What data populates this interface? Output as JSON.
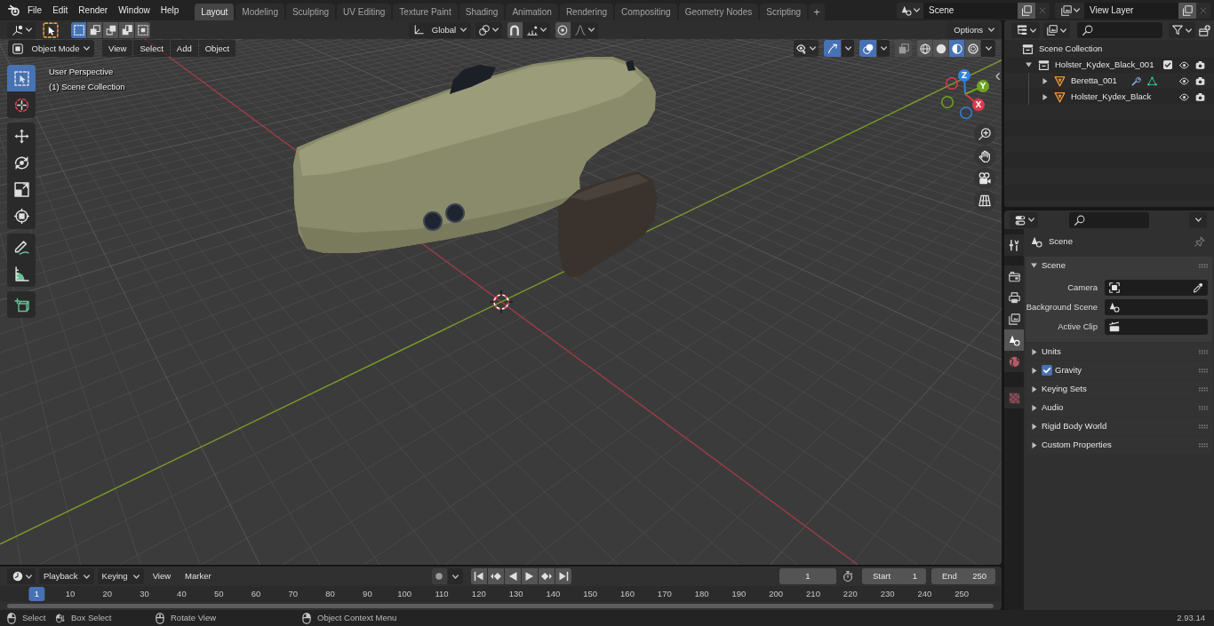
{
  "topbar": {
    "menus": [
      "File",
      "Edit",
      "Render",
      "Window",
      "Help"
    ],
    "workspaces": [
      {
        "label": "Layout",
        "selected": true
      },
      {
        "label": "Modeling",
        "selected": false
      },
      {
        "label": "Sculpting",
        "selected": false
      },
      {
        "label": "UV Editing",
        "selected": false
      },
      {
        "label": "Texture Paint",
        "selected": false
      },
      {
        "label": "Shading",
        "selected": false
      },
      {
        "label": "Animation",
        "selected": false
      },
      {
        "label": "Rendering",
        "selected": false
      },
      {
        "label": "Compositing",
        "selected": false
      },
      {
        "label": "Geometry Nodes",
        "selected": false
      },
      {
        "label": "Scripting",
        "selected": false
      }
    ],
    "add_workspace": "+",
    "scene": "Scene",
    "view_layer": "View Layer"
  },
  "viewport": {
    "tool_header": {
      "selection_modes": [
        {
          "kind": "set",
          "selected": true
        },
        {
          "kind": "extend",
          "selected": false
        },
        {
          "kind": "subtract",
          "selected": false
        },
        {
          "kind": "invert",
          "selected": false
        },
        {
          "kind": "intersect",
          "selected": false
        }
      ],
      "orientation": "Global",
      "snap": {
        "on": false
      },
      "proportional": {
        "on": false
      },
      "options": "Options"
    },
    "header": {
      "mode": "Object Mode",
      "menus": [
        "View",
        "Select",
        "Add",
        "Object"
      ],
      "toggles": [
        {
          "kind": "gizmo",
          "on": true
        },
        {
          "kind": "overlays",
          "on": true
        },
        {
          "kind": "xray",
          "on": false
        }
      ],
      "shading": [
        {
          "kind": "wireframe",
          "selected": false
        },
        {
          "kind": "solid",
          "selected": false
        },
        {
          "kind": "material",
          "selected": true
        },
        {
          "kind": "rendered",
          "selected": false
        }
      ]
    },
    "toolbar": [
      {
        "tools": [
          {
            "kind": "select_box",
            "selected": true
          },
          {
            "kind": "cursor",
            "selected": false
          }
        ]
      },
      {
        "tools": [
          {
            "kind": "move",
            "selected": false
          },
          {
            "kind": "rotate",
            "selected": false
          },
          {
            "kind": "scale",
            "selected": false
          },
          {
            "kind": "transform",
            "selected": false
          }
        ]
      },
      {
        "tools": [
          {
            "kind": "annotate",
            "selected": false
          },
          {
            "kind": "measure",
            "selected": false
          }
        ]
      },
      {
        "tools": [
          {
            "kind": "add_cube",
            "selected": false
          }
        ]
      }
    ],
    "overlay_text": [
      "User Perspective",
      "(1) Scene Collection"
    ],
    "gizmo_axes": [
      {
        "label": "Z",
        "color": "#2f83e0"
      },
      {
        "label": "Y",
        "color": "#6ea420"
      },
      {
        "label": "X",
        "color": "#e0384d"
      }
    ]
  },
  "outliner": {
    "root": "Scene Collection",
    "items": [
      {
        "label": "Holster_Kydex_Black_001",
        "kind": "collection",
        "expanded": true,
        "checked": true,
        "children": [
          {
            "label": "Beretta_001",
            "kind": "object",
            "expanded": false,
            "modifiers": true,
            "mesh": true
          },
          {
            "label": "Holster_Kydex_Black",
            "kind": "object",
            "expanded": false,
            "modifiers": false,
            "mesh": false
          }
        ]
      }
    ]
  },
  "properties": {
    "tab_groups": [
      {
        "tabs": [
          {
            "kind": "tool",
            "selected": false
          }
        ]
      },
      {
        "tabs": [
          {
            "kind": "render",
            "selected": false
          },
          {
            "kind": "output",
            "selected": false
          },
          {
            "kind": "view_layer",
            "selected": false
          },
          {
            "kind": "scene",
            "selected": true
          },
          {
            "kind": "world",
            "selected": false
          }
        ]
      },
      {
        "tabs": [
          {
            "kind": "texture",
            "selected": false
          }
        ]
      }
    ],
    "context": "Scene",
    "panels": [
      {
        "title": "Scene",
        "kind": "plain",
        "expanded": true,
        "fields": [
          {
            "label": "Camera",
            "kind": "object"
          },
          {
            "label": "Background Scene",
            "kind": "scene"
          },
          {
            "label": "Active Clip",
            "kind": "clip"
          }
        ]
      },
      {
        "title": "Units",
        "kind": "plain",
        "expanded": false
      },
      {
        "title": "Gravity",
        "kind": "toggle",
        "checked": true,
        "expanded": false
      },
      {
        "title": "Keying Sets",
        "kind": "plain",
        "expanded": false
      },
      {
        "title": "Audio",
        "kind": "plain",
        "expanded": false
      },
      {
        "title": "Rigid Body World",
        "kind": "plain",
        "expanded": false
      },
      {
        "title": "Custom Properties",
        "kind": "plain",
        "expanded": false
      }
    ]
  },
  "timeline": {
    "menus": [
      {
        "label": "Playback",
        "dropdown": true
      },
      {
        "label": "Keying",
        "dropdown": true
      },
      {
        "label": "View",
        "dropdown": false
      },
      {
        "label": "Marker",
        "dropdown": false
      }
    ],
    "auto_keying": false,
    "current_frame": "1",
    "start": {
      "label": "Start",
      "value": "1"
    },
    "end": {
      "label": "End",
      "value": "250"
    },
    "playhead": "1",
    "ruler": [
      "10",
      "20",
      "30",
      "40",
      "50",
      "60",
      "70",
      "80",
      "90",
      "100",
      "110",
      "120",
      "130",
      "140",
      "150",
      "160",
      "170",
      "180",
      "190",
      "200",
      "210",
      "220",
      "230",
      "240",
      "250"
    ]
  },
  "status_bar": {
    "hints": [
      {
        "kind": "lmb",
        "label": "Select"
      },
      {
        "kind": "lmb_drag",
        "label": "Box Select"
      },
      {
        "kind": "mmb",
        "label": "Rotate View"
      },
      {
        "kind": "rmb",
        "label": "Object Context Menu"
      }
    ],
    "version": "2.93.14"
  }
}
